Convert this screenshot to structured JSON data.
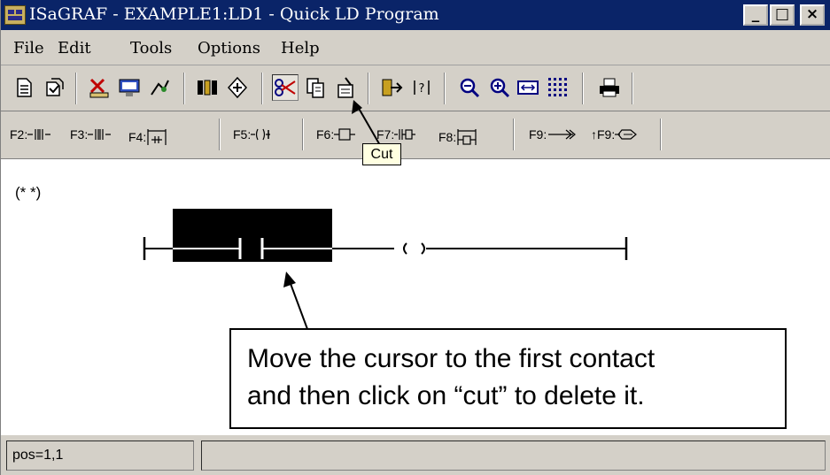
{
  "window": {
    "title": "ISaGRAF - EXAMPLE1:LD1 - Quick LD Program",
    "buttons": {
      "minimize": "_",
      "maximize": "□",
      "close": "×"
    }
  },
  "menu": [
    {
      "label": "File"
    },
    {
      "label": "Edit"
    },
    {
      "label": "Tools"
    },
    {
      "label": "Options"
    },
    {
      "label": "Help"
    }
  ],
  "toolbar": {
    "icons": [
      "new-icon",
      "open-icon",
      "verify-icon",
      "dictionary-icon",
      "variables-icon",
      "library-icon",
      "insert-icon",
      "cut-icon",
      "copy-icon",
      "paste-icon",
      "go-to-icon",
      "question-icon",
      "zoom-out-icon",
      "zoom-in-icon",
      "fit-icon",
      "grid-icon",
      "print-icon"
    ],
    "active": "cut-icon"
  },
  "fkeys": {
    "f2": "F2:",
    "f3": "F3:",
    "f4": "F4:",
    "f5": "F5:",
    "f6": "F6:",
    "f7": "F7:",
    "f8": "F8:",
    "f9": "F9:",
    "sf9": "↑F9:"
  },
  "tooltip": "Cut",
  "editor": {
    "comment": "(* *)"
  },
  "callout": {
    "line1": "Move the cursor to the first contact",
    "line2": "and then click on “cut” to delete it."
  },
  "status": {
    "position": "pos=1,1",
    "message": ""
  },
  "colors": {
    "titlebar": "#0a2468",
    "chrome": "#d4d0c8",
    "selection": "#000000",
    "tooltip": "#ffffe1"
  }
}
